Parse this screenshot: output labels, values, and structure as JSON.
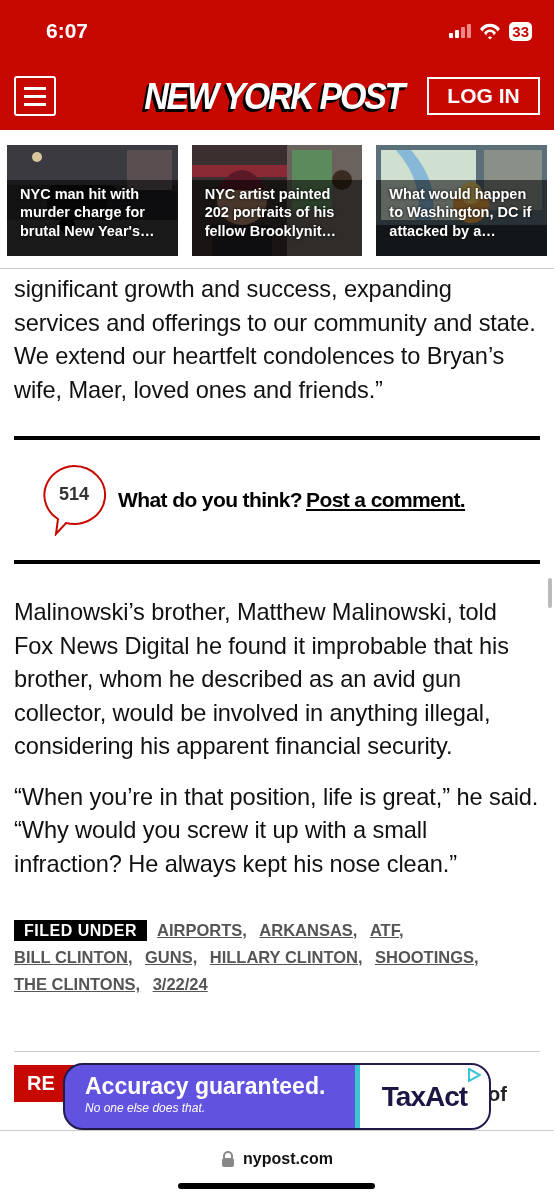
{
  "status_bar": {
    "time": "6:07",
    "battery": "33"
  },
  "header": {
    "logo": "NEW YORK POST",
    "login": "LOG IN"
  },
  "stories": [
    {
      "title": "NYC man hit with murder charge for brutal New Year's…"
    },
    {
      "title": "NYC artist painted 202 portraits of his fellow Brooklynit…"
    },
    {
      "title": "What would happen to Washington, DC if attacked by a…"
    }
  ],
  "paragraphs_top": [
    "significant growth and success, expanding services and offerings to our community and state. We extend our heartfelt condolences to Bryan’s wife, Maer, loved ones and friends.”"
  ],
  "comments": {
    "count": "514",
    "prompt": "What do you think?",
    "link": "Post a comment."
  },
  "paragraphs": [
    "Malinowski’s brother, Matthew Malinowski, told Fox News Digital he found it improbable that his brother, whom he described as an avid gun collector, would be involved in anything illegal, considering his apparent financial security.",
    "“When you’re in that position, life is great,” he said. “Why would you screw it up with a small infraction? He always kept his nose clean.”"
  ],
  "filed_under": {
    "label": "FILED UNDER",
    "tags": [
      "AIRPORTS,",
      "ARKANSAS,",
      "ATF,",
      "BILL CLINTON,",
      "GUNS,",
      "HILLARY CLINTON,",
      "SHOOTINGS,",
      "THE CLINTONS,",
      "3/22/24"
    ]
  },
  "read_more": {
    "label": "RE",
    "text": "of"
  },
  "ad": {
    "headline": "Accuracy guaranteed.",
    "tagline": "No one else does that.",
    "brand": "TaxAct"
  },
  "browser": {
    "url": "nypost.com"
  }
}
